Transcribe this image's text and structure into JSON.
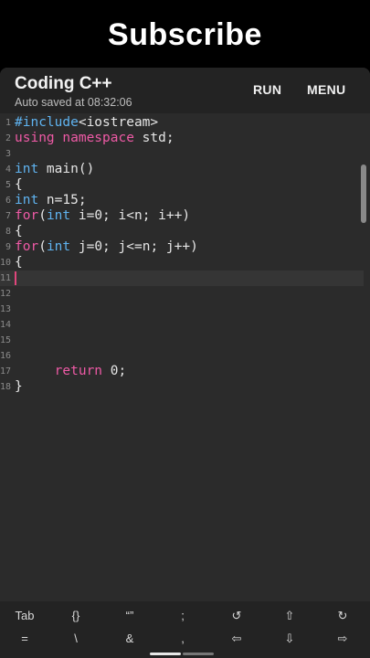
{
  "banner": {
    "title": "Subscribe"
  },
  "app": {
    "title": "Coding C++",
    "subtitle": "Auto saved at 08:32:06",
    "run_label": "RUN",
    "menu_label": "MENU"
  },
  "editor": {
    "current_line": 11,
    "lines": [
      {
        "n": "1",
        "segments": [
          {
            "t": "#include",
            "c": "kw"
          },
          {
            "t": "<iostream>",
            "c": ""
          }
        ]
      },
      {
        "n": "2",
        "segments": [
          {
            "t": "using namespace",
            "c": "kw2"
          },
          {
            "t": " std;",
            "c": ""
          }
        ]
      },
      {
        "n": "3",
        "segments": []
      },
      {
        "n": "4",
        "segments": [
          {
            "t": "int",
            "c": "kw"
          },
          {
            "t": " main()",
            "c": ""
          }
        ]
      },
      {
        "n": "5",
        "segments": [
          {
            "t": "{",
            "c": ""
          }
        ]
      },
      {
        "n": "6",
        "segments": [
          {
            "t": "int",
            "c": "kw"
          },
          {
            "t": " n=15;",
            "c": ""
          }
        ]
      },
      {
        "n": "7",
        "segments": [
          {
            "t": "for",
            "c": "kw2"
          },
          {
            "t": "(",
            "c": ""
          },
          {
            "t": "int",
            "c": "kw"
          },
          {
            "t": " i=0; i<n; i++)",
            "c": ""
          }
        ]
      },
      {
        "n": "8",
        "segments": [
          {
            "t": "{",
            "c": ""
          }
        ]
      },
      {
        "n": "9",
        "segments": [
          {
            "t": "for",
            "c": "kw2"
          },
          {
            "t": "(",
            "c": ""
          },
          {
            "t": "int",
            "c": "kw"
          },
          {
            "t": " j=0; j<=n; j++)",
            "c": ""
          }
        ]
      },
      {
        "n": "10",
        "segments": [
          {
            "t": "{",
            "c": ""
          }
        ]
      },
      {
        "n": "11",
        "segments": []
      },
      {
        "n": "12",
        "segments": []
      },
      {
        "n": "13",
        "segments": []
      },
      {
        "n": "14",
        "segments": []
      },
      {
        "n": "15",
        "segments": []
      },
      {
        "n": "16",
        "segments": []
      },
      {
        "n": "17",
        "segments": [
          {
            "t": "     ",
            "c": ""
          },
          {
            "t": "return",
            "c": "kw2"
          },
          {
            "t": " 0;",
            "c": ""
          }
        ]
      },
      {
        "n": "18",
        "segments": [
          {
            "t": "}",
            "c": ""
          }
        ]
      }
    ]
  },
  "keybar": {
    "row1": [
      "Tab",
      "{}",
      "“”",
      ";",
      "↺",
      "⇧",
      "↻"
    ],
    "row2": [
      "=",
      "\\",
      "&",
      ",",
      "⇦",
      "⇩",
      "⇨"
    ]
  },
  "colors": {
    "background": "#2b2b2b",
    "keyword_blue": "#5fb3f0",
    "keyword_pink": "#ef5aa6",
    "cursor": "#e0467c"
  }
}
